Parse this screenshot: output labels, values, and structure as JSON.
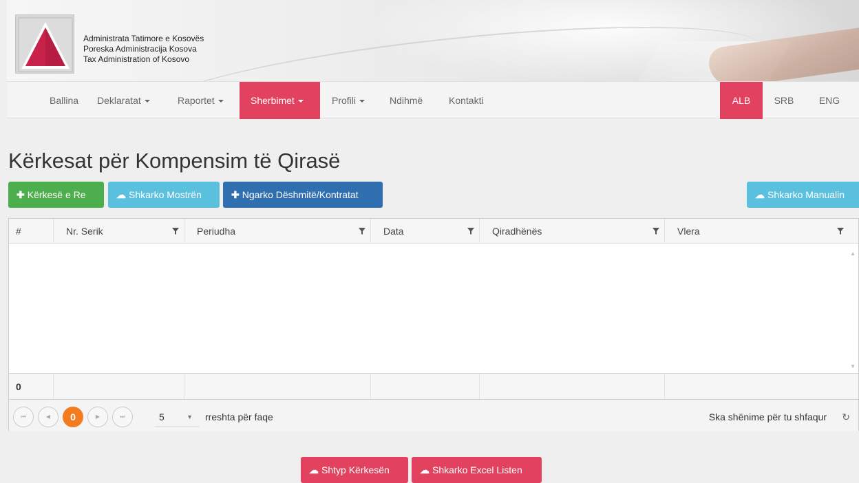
{
  "org": {
    "line1": "Administrata Tatimore e Kosovës",
    "line2": "Poreska Administracija Kosova",
    "line3": "Tax Administration of Kosovo"
  },
  "nav": {
    "items": [
      {
        "label": "Ballina"
      },
      {
        "label": "Deklaratat"
      },
      {
        "label": "Raportet"
      },
      {
        "label": "Sherbimet"
      },
      {
        "label": "Profili"
      },
      {
        "label": "Ndihmë"
      },
      {
        "label": "Kontakti"
      }
    ],
    "langs": [
      "ALB",
      "SRB",
      "ENG"
    ],
    "active_item": "Sherbimet",
    "active_lang": "ALB"
  },
  "page": {
    "title": "Kërkesat për Kompensim të Qirasë"
  },
  "toolbar": {
    "new_request": "Kërkesë e Re",
    "download_sample": "Shkarko Mostrën",
    "upload_evidence": "Ngarko Dëshmitë/Kontratat",
    "download_manual": "Shkarko Manualin"
  },
  "grid": {
    "columns": [
      "#",
      "Nr. Serik",
      "Periudha",
      "Data",
      "Qiradhënës",
      "Vlera"
    ],
    "rows": [],
    "footer_count": "0"
  },
  "pager": {
    "current_page": "0",
    "page_size": "5",
    "page_size_label": "rreshta për faqe",
    "info": "Ska shënime për tu shfaqur"
  },
  "actions": {
    "print_request": "Shtyp Kërkesën",
    "download_excel": "Shkarko Excel Listen"
  },
  "colors": {
    "brand_red": "#e2415f",
    "green": "#4cae4c",
    "cyan": "#5bc0de",
    "blue": "#2f6fb0",
    "pager_active": "#f47c20"
  },
  "icons": {
    "plus": "plus-icon",
    "cloud": "cloud-download-icon",
    "filter": "filter-icon",
    "refresh": "refresh-icon"
  }
}
